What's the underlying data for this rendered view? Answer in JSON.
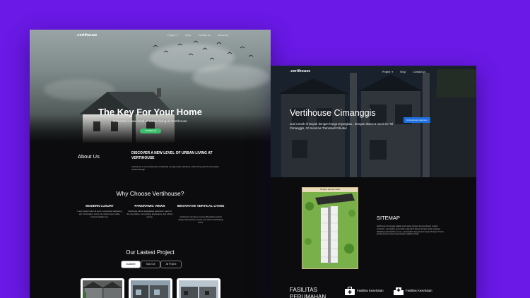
{
  "left": {
    "logo": ".vertihouse",
    "nav": [
      "Project",
      "Shop",
      "Contact Us",
      "About Us"
    ],
    "hero_title": "The Key For Your Home",
    "hero_sub": "Discover a new level of urban living at Vertihouse",
    "hero_button": "Contact Us",
    "about_heading": "About Us",
    "about_title": "DISCOVER A NEW LEVEL OF URBAN LIVING AT VERTIHOUSE",
    "about_body": "Vertihouse is a revolutionary residential complex that redefines urban living with its innovative vertical design.",
    "why_heading": "Why Choose Vertihouse?",
    "features": [
      {
        "title": "MODERN LUXURY",
        "body": "Lorem ipsum dolor sit amet, consectetur adipiscing elit. Ut elit tellus, luctus nec ullamcorper mattis, pulvinar dapibus leo."
      },
      {
        "title": "PANORAMIC VIEWS",
        "body": "Vertihouse offers unparalleled panoramic views of the city skyline, surrounding landscapes, and vibrant streets."
      },
      {
        "title": "INNOVATIVE VERTICAL LIVING",
        "body": "Vertihouse introduces a groundbreaking vertical design that optimizes space and offers breathtaking views."
      }
    ],
    "projects_heading": "Our Lastest Project",
    "tabs": [
      "Available",
      "Sold Out",
      "All Project"
    ]
  },
  "right": {
    "logo": ".vertihouse",
    "nav": [
      "Project",
      "Shop",
      "Contact Us"
    ],
    "hero_title": "Vertihouse Cimanggis",
    "hero_sub": "Jual rumah di Depok dengan harga terjangkau , dengan akses 5 menit ke Tol Cimanggis, 10 menit ke Transmall Cibubur",
    "hero_button": "Hubungi kami sekarang",
    "siteplan_caption": "Tampilan sitemap cluster",
    "sitemap_heading": "SITEMAP",
    "sitemap_body": "Vertihouse Cimanggis adalah perumahan dengan konsep desain modern minimalis, merupakan perumahan ekslusif di Depok dengan lokasi strategis. Dikelilingi oleh fasilitas umum, menawarkan kenyamanan bagi keluarga. Proses pembangunan yang cepat dengan kualitas terbaik.",
    "facilities_heading": "FASILITAS PERUMAHAN",
    "facilities": [
      "Fasilitas Kesehatan",
      "Fasilitas Kesehatan"
    ]
  },
  "colors": {
    "background": "#6a19e6",
    "accent_green": "#3bbf6a",
    "accent_blue": "#1e6fe0"
  }
}
